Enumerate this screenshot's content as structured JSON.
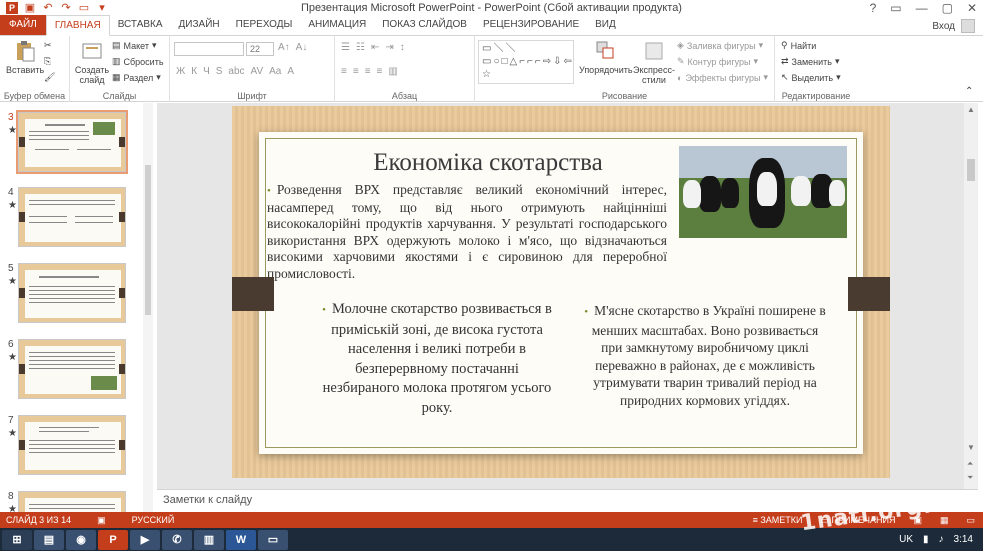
{
  "window": {
    "title": "Презентация Microsoft PowerPoint - PowerPoint (Сбой активации продукта)",
    "controls": [
      "?",
      "▭",
      "—",
      "▢",
      "✕"
    ]
  },
  "tabs": [
    "ФАЙЛ",
    "ГЛАВНАЯ",
    "ВСТАВКА",
    "ДИЗАЙН",
    "ПЕРЕХОДЫ",
    "АНИМАЦИЯ",
    "ПОКАЗ СЛАЙДОВ",
    "РЕЦЕНЗИРОВАНИЕ",
    "ВИД"
  ],
  "active_tab": "ГЛАВНАЯ",
  "signin": "Вход",
  "ribbon": {
    "clipboard": {
      "paste": "Вставить",
      "label": "Буфер обмена"
    },
    "slides": {
      "create_slide": "Создать слайд",
      "layout": "Макет",
      "reset": "Сбросить",
      "section": "Раздел",
      "label": "Слайды"
    },
    "font": {
      "size": "22",
      "label": "Шрифт"
    },
    "paragraph": {
      "label": "Абзац"
    },
    "drawing": {
      "arrange": "Упорядочить",
      "quick_styles": "Экспресс-стили",
      "fill": "Заливка фигуры",
      "outline": "Контур фигуры",
      "effects": "Эффекты фигуры",
      "label": "Рисование"
    },
    "editing": {
      "find": "Найти",
      "replace": "Заменить",
      "select": "Выделить",
      "label": "Редактирование"
    }
  },
  "thumbnails": [
    {
      "num": "3",
      "star": "★"
    },
    {
      "num": "4",
      "star": "★"
    },
    {
      "num": "5",
      "star": "★"
    },
    {
      "num": "6",
      "star": "★"
    },
    {
      "num": "7",
      "star": "★"
    },
    {
      "num": "8",
      "star": "★"
    }
  ],
  "slide": {
    "title": "Економіка скотарства",
    "bullet_main": "Розведення ВРХ представляє великий економічний інтерес, насамперед тому, що від нього отримують найцінніші висококалорійні продуктів харчування. У результаті господарського використання ВРХ одержують молоко і м'ясо, що відзначаються високими харчовими якостями і є сировиною для переробної промисловості.",
    "col_left": "Молочне скотарство розвивається в приміській зоні, де висока густота населення і великі потреби в безперервному постачанні незбираного молока протягом усього року.",
    "col_right": "М'ясне скотарство в Україні поширене в менших масштабах. Воно розвивається при замкнутому виробничому циклі переважно в районах, де є можливість утримувати тварин тривалий період на природних кормових угіддях."
  },
  "notes_placeholder": "Заметки к слайду",
  "status": {
    "slide_of": "СЛАЙД 3 ИЗ 14",
    "language": "РУССКИЙ",
    "notes": "ЗАМЕТКИ",
    "comments": "ПРИМЕЧАНИЯ"
  },
  "taskbar": {
    "lang": "UK",
    "time": "3:14"
  },
  "watermark": "1nati.org.ua",
  "colors": {
    "accent": "#c43e1c",
    "taskbar": "#1c2a3a",
    "slide_wood": "#e9c898",
    "bullet": "#7b8b2a"
  }
}
